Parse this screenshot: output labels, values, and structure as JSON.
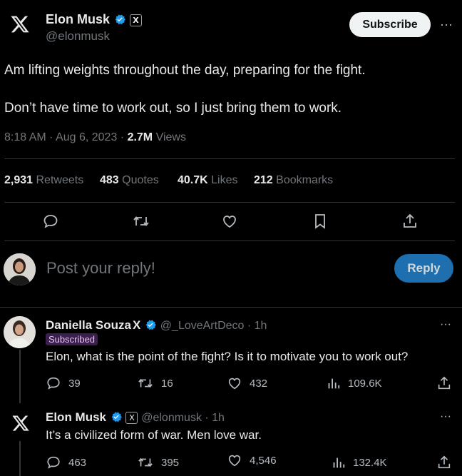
{
  "tweet": {
    "author_name": "Elon Musk",
    "author_handle": "@elonmusk",
    "badge_x": "X",
    "subscribe_label": "Subscribe",
    "more_label": "···",
    "line1": "Am lifting weights throughout the day, preparing for the fight.",
    "line2": "Don’t have time to work out, so I just bring them to work.",
    "time": "8:18 AM · Aug 6, 2023 · ",
    "views_count": "2.7M",
    "views_label": " Views"
  },
  "stats": [
    {
      "count": "2,931",
      "label": " Retweets"
    },
    {
      "count": "483",
      "label": " Quotes"
    },
    {
      "count": "40.7K",
      "label": " Likes"
    },
    {
      "count": "212",
      "label": " Bookmarks"
    }
  ],
  "composer": {
    "placeholder": "Post your reply!",
    "reply_label": "Reply"
  },
  "replies": [
    {
      "name": "Daniella Souza",
      "x_mark": "X",
      "handle_time": "@_LoveArtDeco · 1h",
      "subscribed": "Subscribed",
      "text": "Elon, what is the point of the fight? Is it to motivate you to work out?",
      "comments": "39",
      "retweets": "16",
      "likes": "432",
      "views": "109.6K"
    },
    {
      "name": "Elon Musk",
      "x_mark": "X",
      "handle_time": "@elonmusk · 1h",
      "text": "It’s a civilized form of war. Men love war.",
      "comments": "463",
      "retweets": "395",
      "likes": "4,546",
      "views": "132.4K"
    }
  ],
  "colors": {
    "background": "#000000",
    "text": "#e7e9ea",
    "muted": "#71767b",
    "verified": "#1d9bf0",
    "reply_button": "#1d6fb0",
    "subscribed_badge": "#3b1f4d"
  }
}
